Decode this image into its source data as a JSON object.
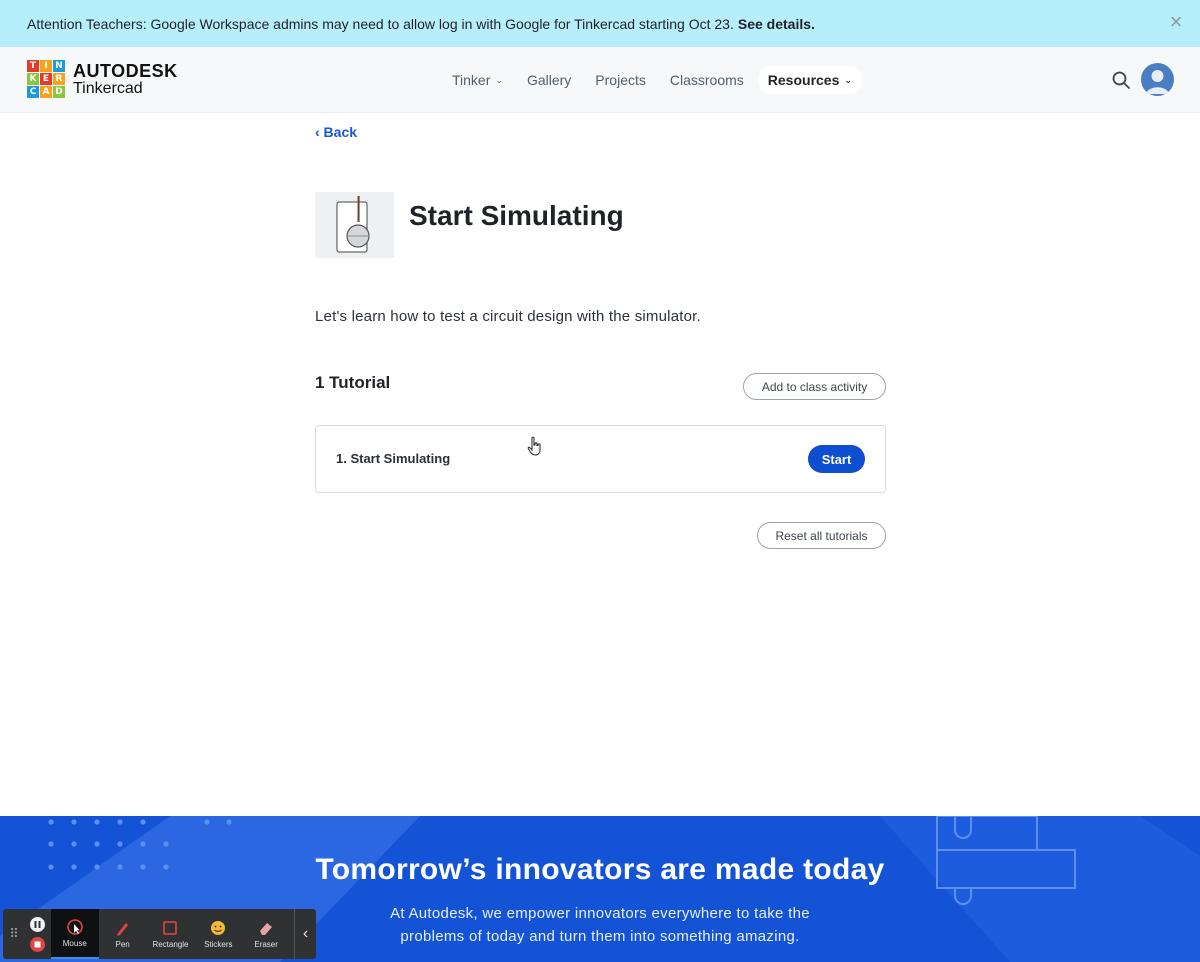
{
  "banner": {
    "text": "Attention Teachers: Google Workspace admins may need to allow log in with Google for Tinkercad starting Oct 23.",
    "link": "See details.",
    "close_glyph": "×"
  },
  "header": {
    "logo": {
      "letters": [
        "T",
        "I",
        "N",
        "K",
        "E",
        "R",
        "C",
        "A",
        "D"
      ],
      "brand": "AUTODESK",
      "product": "Tinkercad"
    },
    "nav": [
      {
        "label": "Tinker",
        "has_dropdown": true
      },
      {
        "label": "Gallery",
        "has_dropdown": false
      },
      {
        "label": "Projects",
        "has_dropdown": false
      },
      {
        "label": "Classrooms",
        "has_dropdown": false
      },
      {
        "label": "Resources",
        "has_dropdown": true,
        "active": true
      }
    ],
    "icons": {
      "search": "search-icon",
      "avatar": "user-avatar"
    }
  },
  "main": {
    "back_label": "‹ Back",
    "title": "Start Simulating",
    "description": "Let's learn how to test a circuit design with the simulator.",
    "section_title": "1 Tutorial",
    "add_button": "Add to class activity",
    "tutorials": [
      {
        "label": "1. Start Simulating",
        "action": "Start"
      }
    ],
    "reset_button": "Reset all tutorials"
  },
  "hero": {
    "title": "Tomorrow’s innovators are made today",
    "subtitle_line1": "At Autodesk, we empower innovators everywhere to take the",
    "subtitle_line2": "problems of today and turn them into something amazing."
  },
  "toolbar": {
    "tools": [
      {
        "label": "Mouse",
        "active": true
      },
      {
        "label": "Pen"
      },
      {
        "label": "Rectangle"
      },
      {
        "label": "Stickers"
      },
      {
        "label": "Eraser"
      }
    ],
    "collapse_glyph": "‹"
  },
  "colors": {
    "banner_bg": "#b7eefb",
    "accent": "#0e4ed1",
    "hero_bg": "#1453d6",
    "logo_tiles": [
      "#e43a2a",
      "#f6a21b",
      "#1e9bd7",
      "#8cc63f",
      "#e43a2a",
      "#f6a21b",
      "#1e9bd7",
      "#f6a21b",
      "#8cc63f"
    ]
  }
}
